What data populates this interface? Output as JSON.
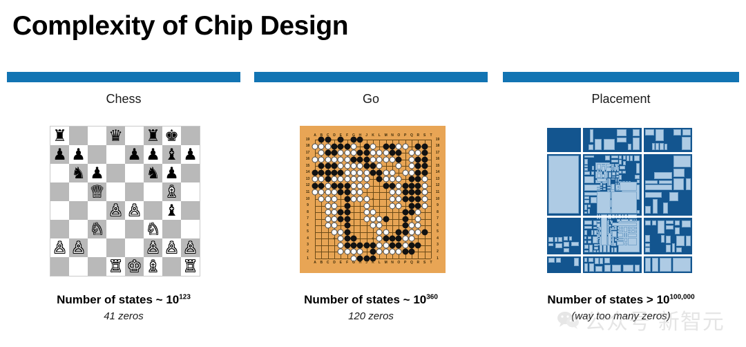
{
  "slide": {
    "title": "Complexity of Chip Design",
    "accent_color": "#1274b3"
  },
  "columns": [
    {
      "key": "chess",
      "heading": "Chess",
      "caption_main_prefix": "Number of states ~ 10",
      "caption_exponent": "123",
      "caption_sub": "41 zeros"
    },
    {
      "key": "go",
      "heading": "Go",
      "caption_main_prefix": "Number of states ~ 10",
      "caption_exponent": "360",
      "caption_sub": "120 zeros"
    },
    {
      "key": "placement",
      "heading": "Placement",
      "caption_main_prefix": "Number of states > 10",
      "caption_exponent": "100,000",
      "caption_sub": "(way too many zeros)"
    }
  ],
  "chess_board": {
    "light_square_color": "#ffffff",
    "dark_square_color": "#b9b9b9",
    "ranks": [
      [
        "r",
        "",
        "",
        "q",
        "",
        "r",
        "k",
        ""
      ],
      [
        "p",
        "p",
        "",
        "",
        "p",
        "p",
        "b",
        "p"
      ],
      [
        "",
        "n",
        "p",
        "",
        "",
        "n",
        "p",
        ""
      ],
      [
        "",
        "",
        "Q",
        "",
        "",
        "",
        "B",
        ""
      ],
      [
        "",
        "",
        "",
        "P",
        "P",
        "",
        "b",
        ""
      ],
      [
        "",
        "",
        "N",
        "",
        "",
        "N",
        "",
        ""
      ],
      [
        "P",
        "P",
        "",
        "",
        "",
        "P",
        "P",
        "P"
      ],
      [
        "",
        "",
        "",
        "R",
        "K",
        "B",
        "",
        "R"
      ]
    ],
    "glyphs": {
      "K": "♔",
      "Q": "♕",
      "R": "♖",
      "B": "♗",
      "N": "♘",
      "P": "♙",
      "k": "♚",
      "q": "♛",
      "r": "♜",
      "b": "♝",
      "n": "♞",
      "p": "♟"
    }
  },
  "go_board": {
    "size": 19,
    "board_color": "#e8a555",
    "line_color": "#6b4a17",
    "column_labels": [
      "A",
      "B",
      "C",
      "D",
      "E",
      "F",
      "G",
      "H",
      "J",
      "K",
      "L",
      "M",
      "N",
      "O",
      "P",
      "Q",
      "R",
      "S",
      "T"
    ],
    "row_labels": [
      "19",
      "18",
      "17",
      "16",
      "15",
      "14",
      "13",
      "12",
      "11",
      "10",
      "9",
      "8",
      "7",
      "6",
      "5",
      "4",
      "3",
      "2",
      "1"
    ],
    "star_points": [
      [
        3,
        3
      ],
      [
        3,
        9
      ],
      [
        3,
        15
      ],
      [
        9,
        3
      ],
      [
        9,
        9
      ],
      [
        9,
        15
      ],
      [
        15,
        3
      ],
      [
        15,
        9
      ],
      [
        15,
        15
      ]
    ],
    "black_stones": [
      [
        1,
        0
      ],
      [
        2,
        0
      ],
      [
        4,
        0
      ],
      [
        6,
        0
      ],
      [
        7,
        0
      ],
      [
        3,
        1
      ],
      [
        4,
        1
      ],
      [
        5,
        1
      ],
      [
        8,
        1
      ],
      [
        11,
        1
      ],
      [
        12,
        1
      ],
      [
        16,
        1
      ],
      [
        17,
        1
      ],
      [
        2,
        2
      ],
      [
        3,
        2
      ],
      [
        7,
        2
      ],
      [
        8,
        2
      ],
      [
        12,
        2
      ],
      [
        13,
        2
      ],
      [
        17,
        2
      ],
      [
        6,
        3
      ],
      [
        7,
        3
      ],
      [
        8,
        3
      ],
      [
        13,
        3
      ],
      [
        16,
        3
      ],
      [
        17,
        3
      ],
      [
        1,
        4
      ],
      [
        2,
        4
      ],
      [
        3,
        4
      ],
      [
        8,
        4
      ],
      [
        9,
        4
      ],
      [
        16,
        4
      ],
      [
        17,
        4
      ],
      [
        0,
        5
      ],
      [
        1,
        5
      ],
      [
        2,
        5
      ],
      [
        3,
        5
      ],
      [
        4,
        5
      ],
      [
        9,
        5
      ],
      [
        10,
        5
      ],
      [
        16,
        5
      ],
      [
        17,
        5
      ],
      [
        2,
        6
      ],
      [
        10,
        6
      ],
      [
        15,
        6
      ],
      [
        16,
        6
      ],
      [
        0,
        7
      ],
      [
        1,
        7
      ],
      [
        3,
        7
      ],
      [
        4,
        7
      ],
      [
        5,
        7
      ],
      [
        11,
        7
      ],
      [
        12,
        7
      ],
      [
        14,
        7
      ],
      [
        15,
        7
      ],
      [
        16,
        7
      ],
      [
        4,
        8
      ],
      [
        5,
        8
      ],
      [
        14,
        8
      ],
      [
        15,
        8
      ],
      [
        16,
        8
      ],
      [
        17,
        8
      ],
      [
        5,
        9
      ],
      [
        14,
        9
      ],
      [
        15,
        9
      ],
      [
        16,
        9
      ],
      [
        5,
        10
      ],
      [
        15,
        10
      ],
      [
        16,
        10
      ],
      [
        4,
        11
      ],
      [
        5,
        11
      ],
      [
        14,
        11
      ],
      [
        15,
        11
      ],
      [
        4,
        12
      ],
      [
        5,
        12
      ],
      [
        11,
        12
      ],
      [
        14,
        12
      ],
      [
        5,
        13
      ],
      [
        14,
        13
      ],
      [
        5,
        14
      ],
      [
        13,
        14
      ],
      [
        14,
        14
      ],
      [
        17,
        14
      ],
      [
        5,
        15
      ],
      [
        6,
        15
      ],
      [
        11,
        15
      ],
      [
        12,
        15
      ],
      [
        13,
        15
      ],
      [
        5,
        16
      ],
      [
        6,
        16
      ],
      [
        7,
        16
      ],
      [
        8,
        16
      ],
      [
        9,
        16
      ],
      [
        12,
        16
      ],
      [
        13,
        16
      ],
      [
        15,
        16
      ],
      [
        16,
        16
      ],
      [
        9,
        17
      ],
      [
        14,
        17
      ],
      [
        15,
        17
      ],
      [
        7,
        18
      ],
      [
        8,
        18
      ],
      [
        9,
        18
      ]
    ],
    "white_stones": [
      [
        0,
        1
      ],
      [
        1,
        1
      ],
      [
        2,
        1
      ],
      [
        6,
        1
      ],
      [
        9,
        1
      ],
      [
        13,
        1
      ],
      [
        14,
        1
      ],
      [
        1,
        2
      ],
      [
        4,
        2
      ],
      [
        5,
        2
      ],
      [
        6,
        2
      ],
      [
        9,
        2
      ],
      [
        10,
        2
      ],
      [
        11,
        2
      ],
      [
        15,
        2
      ],
      [
        16,
        2
      ],
      [
        0,
        3
      ],
      [
        1,
        3
      ],
      [
        2,
        3
      ],
      [
        3,
        3
      ],
      [
        4,
        3
      ],
      [
        5,
        3
      ],
      [
        9,
        3
      ],
      [
        10,
        3
      ],
      [
        11,
        3
      ],
      [
        12,
        3
      ],
      [
        15,
        3
      ],
      [
        4,
        4
      ],
      [
        5,
        4
      ],
      [
        6,
        4
      ],
      [
        7,
        4
      ],
      [
        10,
        4
      ],
      [
        13,
        4
      ],
      [
        15,
        4
      ],
      [
        5,
        5
      ],
      [
        6,
        5
      ],
      [
        7,
        5
      ],
      [
        8,
        5
      ],
      [
        11,
        5
      ],
      [
        12,
        5
      ],
      [
        14,
        5
      ],
      [
        15,
        5
      ],
      [
        3,
        6
      ],
      [
        4,
        6
      ],
      [
        5,
        6
      ],
      [
        6,
        6
      ],
      [
        7,
        6
      ],
      [
        8,
        6
      ],
      [
        11,
        6
      ],
      [
        12,
        6
      ],
      [
        13,
        6
      ],
      [
        17,
        6
      ],
      [
        0,
        6
      ],
      [
        1,
        6
      ],
      [
        2,
        7
      ],
      [
        6,
        7
      ],
      [
        7,
        7
      ],
      [
        8,
        7
      ],
      [
        13,
        7
      ],
      [
        17,
        7
      ],
      [
        0,
        8
      ],
      [
        1,
        8
      ],
      [
        2,
        8
      ],
      [
        3,
        8
      ],
      [
        6,
        8
      ],
      [
        7,
        8
      ],
      [
        12,
        8
      ],
      [
        13,
        8
      ],
      [
        17,
        8
      ],
      [
        1,
        9
      ],
      [
        2,
        9
      ],
      [
        3,
        9
      ],
      [
        6,
        9
      ],
      [
        7,
        9
      ],
      [
        8,
        9
      ],
      [
        12,
        9
      ],
      [
        13,
        9
      ],
      [
        17,
        9
      ],
      [
        2,
        10
      ],
      [
        3,
        10
      ],
      [
        8,
        10
      ],
      [
        12,
        10
      ],
      [
        13,
        10
      ],
      [
        17,
        10
      ],
      [
        2,
        11
      ],
      [
        3,
        11
      ],
      [
        8,
        11
      ],
      [
        9,
        11
      ],
      [
        16,
        11
      ],
      [
        2,
        12
      ],
      [
        3,
        12
      ],
      [
        8,
        12
      ],
      [
        9,
        12
      ],
      [
        10,
        12
      ],
      [
        16,
        12
      ],
      [
        2,
        13
      ],
      [
        3,
        13
      ],
      [
        9,
        13
      ],
      [
        10,
        13
      ],
      [
        15,
        13
      ],
      [
        16,
        13
      ],
      [
        3,
        14
      ],
      [
        4,
        14
      ],
      [
        10,
        14
      ],
      [
        11,
        14
      ],
      [
        15,
        14
      ],
      [
        16,
        14
      ],
      [
        4,
        15
      ],
      [
        10,
        15
      ],
      [
        14,
        15
      ],
      [
        15,
        15
      ],
      [
        4,
        16
      ],
      [
        10,
        16
      ],
      [
        11,
        16
      ],
      [
        14,
        16
      ],
      [
        4,
        17
      ],
      [
        5,
        17
      ],
      [
        6,
        17
      ],
      [
        7,
        17
      ],
      [
        10,
        17
      ],
      [
        11,
        17
      ],
      [
        12,
        17
      ],
      [
        13,
        17
      ],
      [
        6,
        18
      ]
    ]
  },
  "placement": {
    "background_color": "#13558f",
    "block_color": "#aecbe4",
    "channel_color": "#ffffff"
  },
  "watermark": {
    "icon": "wechat-icon",
    "text": "公众号 新智元"
  }
}
